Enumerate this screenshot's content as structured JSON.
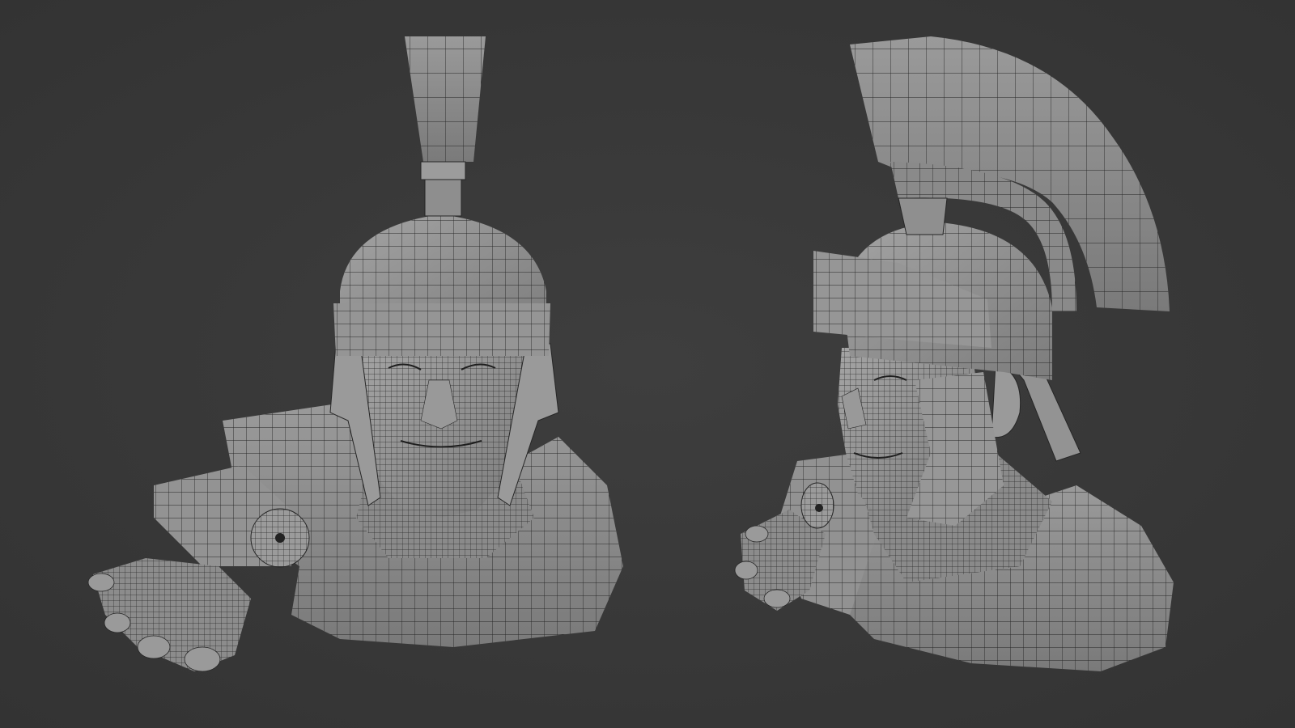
{
  "scene": {
    "background_color": "#3a3a3a",
    "mesh_fill": "#8e8e8e",
    "mesh_light": "#a6a6a6",
    "mesh_dark": "#6a6a6a",
    "wire_color": "#262626"
  },
  "views": [
    {
      "id": "front",
      "subject": "roman-soldier-bust"
    },
    {
      "id": "three-quarter",
      "subject": "roman-soldier-bust"
    }
  ]
}
